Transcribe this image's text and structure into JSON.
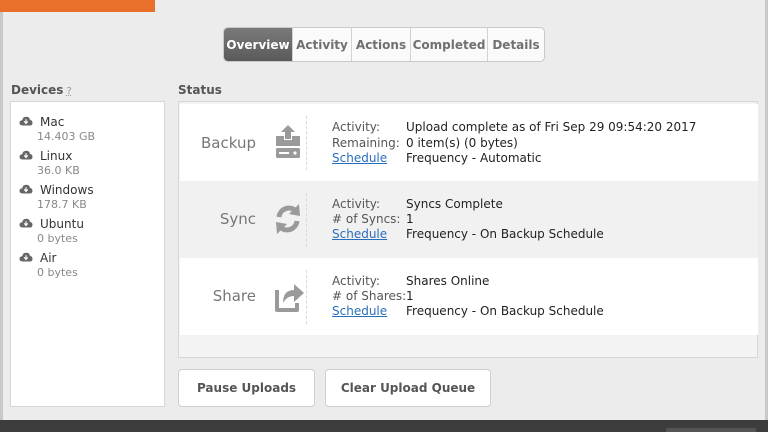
{
  "tabs": [
    {
      "label": "Overview",
      "active": true
    },
    {
      "label": "Activity",
      "active": false
    },
    {
      "label": "Actions",
      "active": false
    },
    {
      "label": "Completed",
      "active": false
    },
    {
      "label": "Details",
      "active": false
    }
  ],
  "devices": {
    "title": "Devices",
    "help": "?",
    "items": [
      {
        "name": "Mac",
        "size": "14.403 GB",
        "icon": "cloud-icon"
      },
      {
        "name": "Linux",
        "size": "36.0 KB",
        "icon": "cloud-icon"
      },
      {
        "name": "Windows",
        "size": "178.7 KB",
        "icon": "cloud-icon"
      },
      {
        "name": "Ubuntu",
        "size": "0 bytes",
        "icon": "cloud-icon"
      },
      {
        "name": "Air",
        "size": "0 bytes",
        "icon": "cloud-icon"
      }
    ]
  },
  "status": {
    "title": "Status",
    "rows": [
      {
        "name": "Backup",
        "icon": "backup-drive-icon",
        "fields": [
          {
            "label": "Activity:",
            "value": "Upload complete as of Fri Sep 29 09:54:20 2017"
          },
          {
            "label": "Remaining:",
            "value": "0 item(s) (0 bytes)"
          }
        ],
        "schedule_link": "Schedule",
        "frequency": "Frequency - Automatic"
      },
      {
        "name": "Sync",
        "icon": "sync-icon",
        "fields": [
          {
            "label": "Activity:",
            "value": "Syncs Complete"
          },
          {
            "label": "# of Syncs:",
            "value": "1"
          }
        ],
        "schedule_link": "Schedule",
        "frequency": "Frequency - On Backup Schedule"
      },
      {
        "name": "Share",
        "icon": "share-icon",
        "fields": [
          {
            "label": "Activity:",
            "value": "Shares Online"
          },
          {
            "label": "# of Shares:",
            "value": "1"
          }
        ],
        "schedule_link": "Schedule",
        "frequency": "Frequency - On Backup Schedule"
      }
    ]
  },
  "buttons": {
    "pause": "Pause Uploads",
    "clear": "Clear Upload Queue"
  },
  "colors": {
    "accent": "#e8702a",
    "link": "#2a6ebb",
    "active_tab": "#6a6a6a"
  }
}
